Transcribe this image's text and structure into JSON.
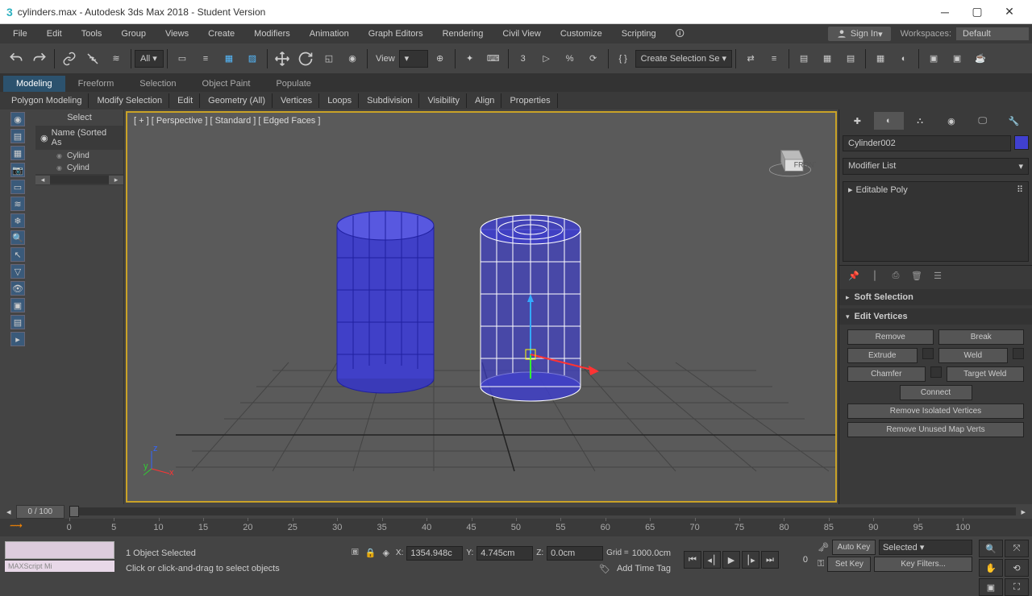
{
  "window": {
    "title": "cylinders.max - Autodesk 3ds Max 2018 - Student Version"
  },
  "menu": [
    "File",
    "Edit",
    "Tools",
    "Group",
    "Views",
    "Create",
    "Modifiers",
    "Animation",
    "Graph Editors",
    "Rendering",
    "Civil View",
    "Customize",
    "Scripting"
  ],
  "signin": "Sign In",
  "workspace_label": "Workspaces:",
  "workspace_value": "Default",
  "toolbar": {
    "all": "All",
    "view": "View",
    "selset": "Create Selection Se"
  },
  "ribbon_tabs": [
    "Modeling",
    "Freeform",
    "Selection",
    "Object Paint",
    "Populate"
  ],
  "ribbon_sub": [
    "Polygon Modeling",
    "Modify Selection",
    "Edit",
    "Geometry (All)",
    "Vertices",
    "Loops",
    "Subdivision",
    "Visibility",
    "Align",
    "Properties"
  ],
  "scene": {
    "select": "Select",
    "sort": "Name (Sorted As",
    "items": [
      "Cylind",
      "Cylind"
    ]
  },
  "viewport_label": "[ + ] [ Perspective ] [ Standard ] [ Edged Faces ]",
  "object": {
    "name": "Cylinder002",
    "modifier_list": "Modifier List",
    "stack": "Editable Poly"
  },
  "rollouts": {
    "soft_sel": "Soft Selection",
    "edit_verts": "Edit Vertices",
    "buttons": {
      "remove": "Remove",
      "break": "Break",
      "extrude": "Extrude",
      "weld": "Weld",
      "chamfer": "Chamfer",
      "target_weld": "Target Weld",
      "connect": "Connect",
      "remove_iso": "Remove Isolated Vertices",
      "remove_unused": "Remove Unused Map Verts"
    }
  },
  "time": {
    "label": "0 / 100",
    "ticks": [
      0,
      5,
      10,
      15,
      20,
      25,
      30,
      35,
      40,
      45,
      50,
      55,
      60,
      65,
      70,
      75,
      80,
      85,
      90,
      95,
      100
    ]
  },
  "status": {
    "selected": "1 Object Selected",
    "prompt": "Click or click-and-drag to select objects",
    "maxscript": "MAXScript Mi",
    "x": "1354.948c",
    "y": "4.745cm",
    "z": "0.0cm",
    "grid": "1000.0cm",
    "add_time_tag": "Add Time Tag"
  },
  "anim": {
    "autokey": "Auto Key",
    "setkey": "Set Key",
    "selected": "Selected",
    "keyfilters": "Key Filters..."
  }
}
